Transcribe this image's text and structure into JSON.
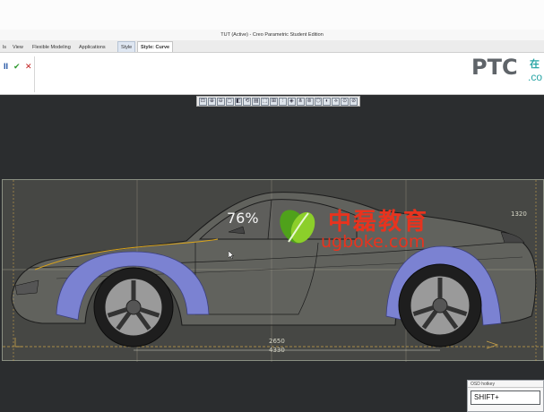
{
  "window": {
    "title": "TUT (Active) - Creo Parametric Student Edition"
  },
  "tabs": [
    {
      "label": "ls"
    },
    {
      "label": "View"
    },
    {
      "label": "Flexible Modeling"
    },
    {
      "label": "Applications"
    },
    {
      "label": "Style"
    },
    {
      "label": "Style: Curve"
    }
  ],
  "ribbon": {
    "pause_symbol": "II",
    "ok_symbol": "✔",
    "cancel_symbol": "✕",
    "logo": "PTC",
    "logo_extra_top": "在",
    "logo_extra_bottom": ".co"
  },
  "view_toolbar": {
    "buttons": [
      "⊡",
      "⊕",
      "⊖",
      "▢",
      "◧",
      "⟲",
      "▤",
      "⬚",
      "⊞",
      "⫶",
      "◈",
      "⋔",
      "⊚",
      "⬡",
      "◐",
      "⟡",
      "⊙",
      "⊘"
    ]
  },
  "viewport": {
    "regen_progress": "76%",
    "dimension_height": "1320",
    "dimension_wheelbase": "2650",
    "dimension_length": "4330"
  },
  "watermark": {
    "chinese": "中磊教育",
    "url": "ugboke.com"
  },
  "osd": {
    "title": "OSD hotkey",
    "value": "SHIFT+"
  },
  "colors": {
    "viewport_bg": "#2b2d2f",
    "wheel_arch": "#7b82d2",
    "watermark": "#e8331e",
    "logo_green": "#4fa11b"
  }
}
